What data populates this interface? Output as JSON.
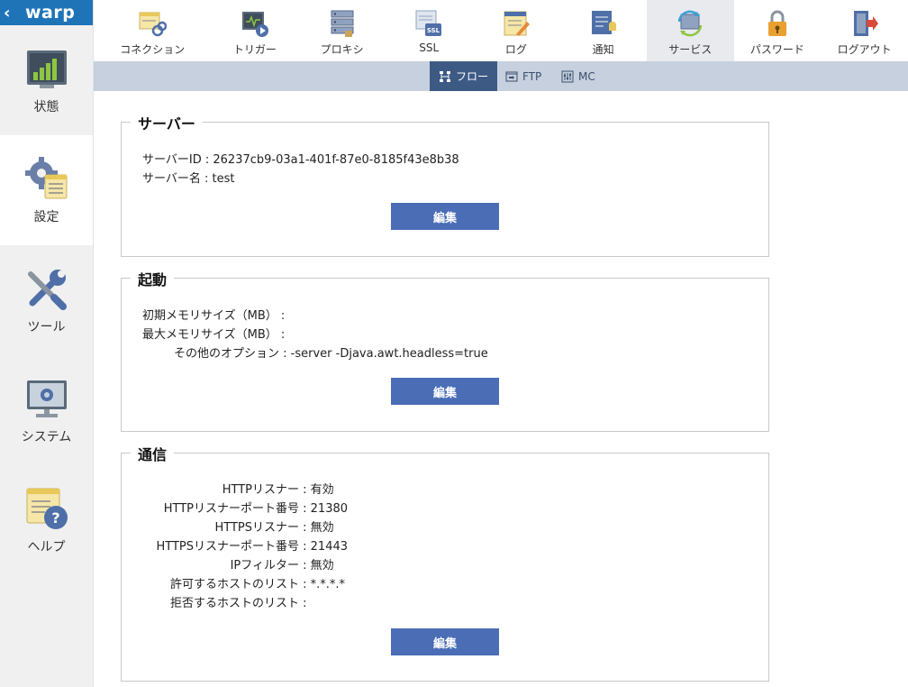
{
  "app": {
    "brand": "warp",
    "back_icon": "chevron-left-icon"
  },
  "sidebar": {
    "items": [
      {
        "label": "状態",
        "icon": "bar-chart-icon",
        "active": false
      },
      {
        "label": "設定",
        "icon": "settings-gear-icon",
        "active": true
      },
      {
        "label": "ツール",
        "icon": "wrench-screwdriver-icon",
        "active": false
      },
      {
        "label": "システム",
        "icon": "monitor-gear-icon",
        "active": false
      },
      {
        "label": "ヘルプ",
        "icon": "help-icon",
        "active": false
      }
    ]
  },
  "topnav": {
    "tabs": [
      {
        "label": "コネクション",
        "icon": "connection-icon",
        "active": false
      },
      {
        "label": "トリガー",
        "icon": "trigger-icon",
        "active": false
      },
      {
        "label": "プロキシ",
        "icon": "proxy-icon",
        "active": false
      },
      {
        "label": "SSL",
        "icon": "ssl-icon",
        "active": false
      },
      {
        "label": "ログ",
        "icon": "log-icon",
        "active": false
      },
      {
        "label": "通知",
        "icon": "notification-icon",
        "active": false
      },
      {
        "label": "サービス",
        "icon": "service-icon",
        "active": true
      },
      {
        "label": "パスワード",
        "icon": "password-lock-icon",
        "active": false
      },
      {
        "label": "ログアウト",
        "icon": "logout-icon",
        "active": false
      }
    ]
  },
  "subnav": {
    "tabs": [
      {
        "label": "フロー",
        "icon": "flow-icon",
        "active": true
      },
      {
        "label": "FTP",
        "icon": "ftp-icon",
        "active": false
      },
      {
        "label": "MC",
        "icon": "mc-icon",
        "active": false
      }
    ]
  },
  "server": {
    "title": "サーバー",
    "id_label": "サーバーID",
    "id_value": "26237cb9-03a1-401f-87e0-8185f43e8b38",
    "name_label": "サーバー名",
    "name_value": "test",
    "edit": "編集"
  },
  "startup": {
    "title": "起動",
    "init_mem_label": "初期メモリサイズ（MB）",
    "init_mem_value": "",
    "max_mem_label": "最大メモリサイズ（MB）",
    "max_mem_value": "",
    "other_label": "その他のオプション",
    "other_value": "-server -Djava.awt.headless=true",
    "edit": "編集"
  },
  "comm": {
    "title": "通信",
    "rows": [
      {
        "label": "HTTPリスナー",
        "value": "有効"
      },
      {
        "label": "HTTPリスナーポート番号",
        "value": "21380"
      },
      {
        "label": "HTTPSリスナー",
        "value": "無効"
      },
      {
        "label": "HTTPSリスナーポート番号",
        "value": "21443"
      },
      {
        "label": "IPフィルター",
        "value": "無効"
      },
      {
        "label": "許可するホストのリスト",
        "value": "*.*.*.*"
      },
      {
        "label": "拒否するホストのリスト",
        "value": ""
      }
    ],
    "edit": "編集"
  },
  "colors": {
    "brand": "#1f74b8",
    "button": "#4a6db6",
    "subnav_active": "#3d5a85"
  }
}
